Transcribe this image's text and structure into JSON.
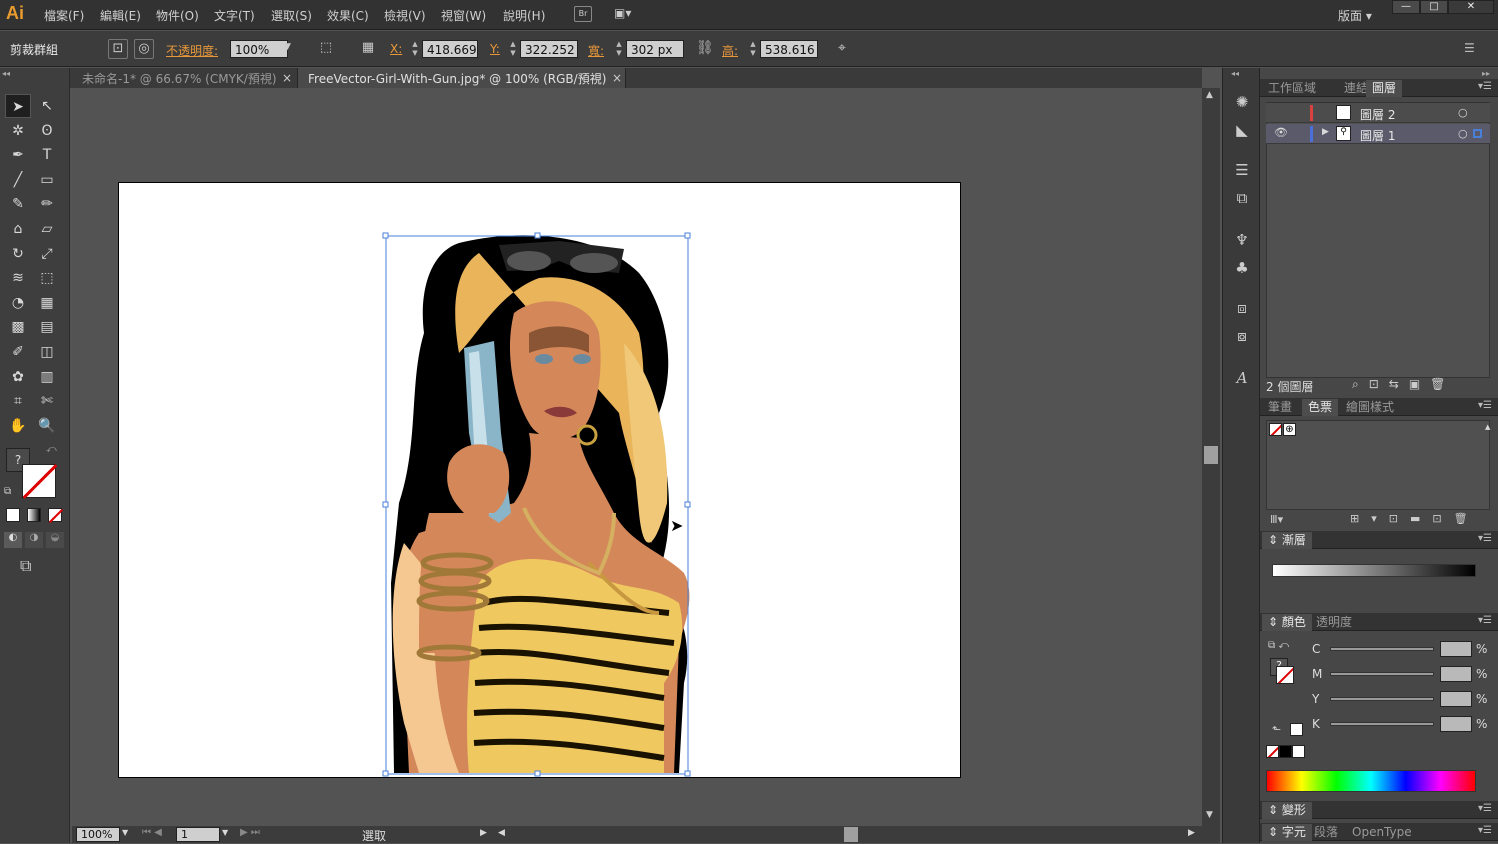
{
  "app": {
    "logo": "Ai"
  },
  "menu": [
    "檔案(F)",
    "編輯(E)",
    "物件(O)",
    "文字(T)",
    "選取(S)",
    "效果(C)",
    "檢視(V)",
    "視窗(W)",
    "說明(H)"
  ],
  "bridge_label": "Br",
  "workspace": {
    "label": "版面 ▾"
  },
  "window_buttons": {
    "minimize": "—",
    "maximize": "□",
    "close": "✕"
  },
  "control": {
    "selection": "剪裁群組",
    "opacity_label": "不透明度:",
    "opacity_value": "100%",
    "x_label": "X:",
    "x_value": "418.669",
    "y_label": "Y:",
    "y_value": "322.252",
    "w_label": "寬:",
    "w_value": "302 px",
    "h_label": "高:",
    "h_value": "538.616"
  },
  "tabs": [
    {
      "label": "未命名-1* @ 66.67% (CMYK/預視)",
      "close": "×"
    },
    {
      "label": "FreeVector-Girl-With-Gun.jpg* @ 100% (RGB/預視)",
      "close": "×"
    }
  ],
  "tools": [
    [
      "selection-tool-icon",
      "➤"
    ],
    [
      "direct-selection-tool-icon",
      "↖"
    ],
    [
      "magic-wand-tool-icon",
      "✲"
    ],
    [
      "lasso-tool-icon",
      "ʘ"
    ],
    [
      "pen-tool-icon",
      "✒"
    ],
    [
      "type-tool-icon",
      "T"
    ],
    [
      "line-tool-icon",
      "╱"
    ],
    [
      "rectangle-tool-icon",
      "▭"
    ],
    [
      "paintbrush-tool-icon",
      "✎"
    ],
    [
      "pencil-tool-icon",
      "✏"
    ],
    [
      "blob-brush-tool-icon",
      "⌂"
    ],
    [
      "eraser-tool-icon",
      "▱"
    ],
    [
      "rotate-tool-icon",
      "↻"
    ],
    [
      "scale-tool-icon",
      "⤢"
    ],
    [
      "warp-tool-icon",
      "≋"
    ],
    [
      "free-transform-tool-icon",
      "⬚"
    ],
    [
      "shape-builder-tool-icon",
      "◔"
    ],
    [
      "perspective-grid-tool-icon",
      "▦"
    ],
    [
      "mesh-tool-icon",
      "▩"
    ],
    [
      "gradient-tool-icon",
      "▤"
    ],
    [
      "eyedropper-tool-icon",
      "✐"
    ],
    [
      "blend-tool-icon",
      "◫"
    ],
    [
      "symbol-sprayer-tool-icon",
      "✿"
    ],
    [
      "column-graph-tool-icon",
      "▥"
    ],
    [
      "artboard-tool-icon",
      "⌗"
    ],
    [
      "slice-tool-icon",
      "✄"
    ],
    [
      "hand-tool-icon",
      "✋"
    ],
    [
      "zoom-tool-icon",
      "🔍"
    ]
  ],
  "layers_panel": {
    "tabs": [
      "工作區域",
      "連結",
      "圖層"
    ],
    "layers": [
      {
        "name": "圖層 2"
      },
      {
        "name": "圖層 1"
      }
    ],
    "count": "2 個圖層"
  },
  "swatch_panel": {
    "tabs": [
      "筆畫",
      "色票",
      "繪圖樣式"
    ]
  },
  "gradient_panel": {
    "title": "漸層"
  },
  "color_panel": {
    "tabs": [
      "顏色",
      "透明度"
    ],
    "channels": [
      "C",
      "M",
      "Y",
      "K"
    ],
    "percent": "%"
  },
  "transform_panel": {
    "title": "變形"
  },
  "char_panel": {
    "tabs": [
      "字元",
      "段落",
      "OpenType"
    ]
  },
  "status": {
    "zoom": "100%",
    "artboard": "1",
    "mode": "選取"
  },
  "colors": {
    "accent_orange": "#e8983a",
    "selection_blue": "#4a7fd8",
    "layer_red": "#d94040",
    "layer_blue": "#4a6fd8"
  }
}
